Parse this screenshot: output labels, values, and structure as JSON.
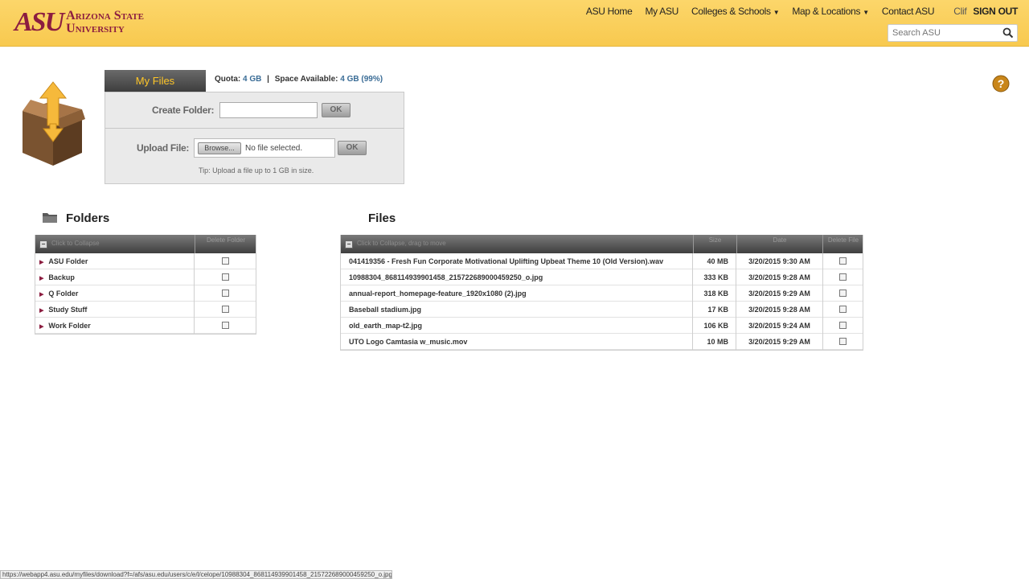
{
  "header": {
    "logo_mark": "ASU",
    "logo_line1": "Arizona State",
    "logo_line2": "University",
    "nav": {
      "asu_home": "ASU Home",
      "my_asu": "My ASU",
      "colleges": "Colleges & Schools",
      "map": "Map & Locations",
      "contact": "Contact ASU",
      "user": "Clif",
      "signout": "SIGN OUT"
    },
    "search_placeholder": "Search ASU"
  },
  "myfiles": {
    "tab_label": "My Files",
    "quota_label": "Quota:",
    "quota_value": "4 GB",
    "quota_sep": "|",
    "space_label": "Space Available:",
    "space_value": "4 GB (99%)",
    "create_folder_label": "Create Folder:",
    "create_folder_value": "",
    "ok_label": "OK",
    "upload_label": "Upload File:",
    "browse_label": "Browse...",
    "no_file_label": "No file selected.",
    "tip": "Tip: Upload a file up to 1 GB in size."
  },
  "folders": {
    "title": "Folders",
    "header_text": "Click to Collapse",
    "delete_header": "Delete Folder",
    "items": [
      {
        "name": "ASU Folder"
      },
      {
        "name": "Backup"
      },
      {
        "name": "Q Folder"
      },
      {
        "name": "Study Stuff"
      },
      {
        "name": "Work Folder"
      }
    ]
  },
  "files": {
    "title": "Files",
    "header_text": "Click to Collapse, drag to move",
    "columns": {
      "size": "Size",
      "date": "Date",
      "delete": "Delete File"
    },
    "rows": [
      {
        "name": "041419356 - Fresh Fun Corporate Motivational Uplifting Upbeat Theme 10 (Old Version).wav",
        "size": "40 MB",
        "date": "3/20/2015 9:30 AM"
      },
      {
        "name": "10988304_868114939901458_215722689000459250_o.jpg",
        "size": "333 KB",
        "date": "3/20/2015 9:28 AM"
      },
      {
        "name": "annual-report_homepage-feature_1920x1080 (2).jpg",
        "size": "318 KB",
        "date": "3/20/2015 9:29 AM"
      },
      {
        "name": "Baseball stadium.jpg",
        "size": "17 KB",
        "date": "3/20/2015 9:28 AM"
      },
      {
        "name": "old_earth_map-t2.jpg",
        "size": "106 KB",
        "date": "3/20/2015 9:24 AM"
      },
      {
        "name": "UTO Logo Camtasia w_music.mov",
        "size": "10 MB",
        "date": "3/20/2015 9:29 AM"
      }
    ]
  },
  "statusbar": {
    "url": "https://webapp4.asu.edu/myfiles/download?f=/afs/asu.edu/users/c/e/l/celope/10988304_868114939901458_215722689000459250_o.jpg"
  },
  "colors": {
    "header_gold": "#ffc627",
    "maroon": "#8c1d40"
  }
}
